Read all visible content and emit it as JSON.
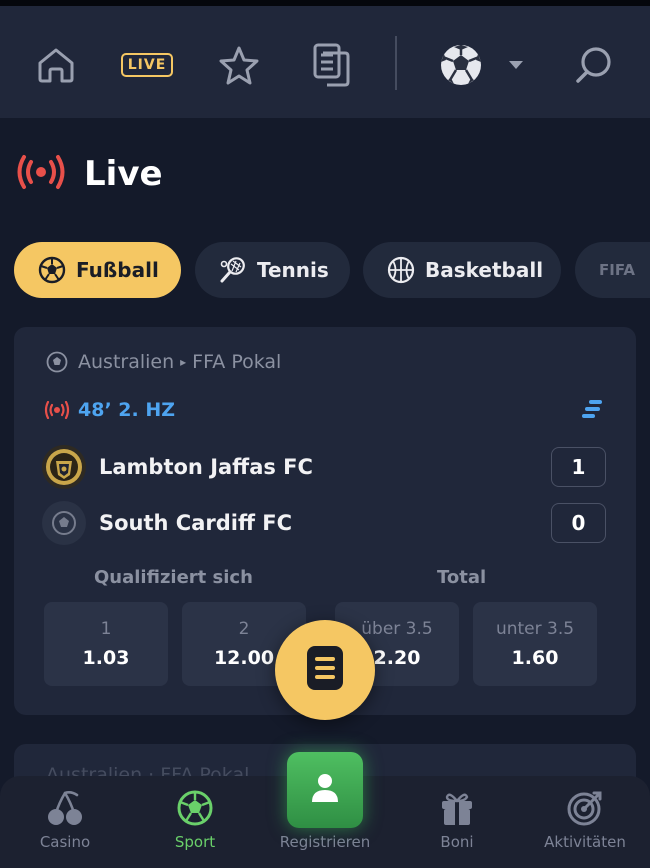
{
  "topbar": {
    "live_badge": "LIVE",
    "icons": [
      "home-icon",
      "live-badge",
      "star-icon",
      "betslip-icon",
      "soccer-ball-icon",
      "chevron-down-icon",
      "search-icon"
    ]
  },
  "section": {
    "title": "Live",
    "icon": "live-broadcast-icon"
  },
  "sports": [
    {
      "label": "Fußball",
      "icon": "soccer-ball-icon",
      "active": true
    },
    {
      "label": "Tennis",
      "icon": "tennis-racket-icon",
      "active": false
    },
    {
      "label": "Basketball",
      "icon": "basketball-icon",
      "active": false
    },
    {
      "label": "FIFA",
      "icon": "",
      "active": false
    }
  ],
  "match": {
    "country": "Australien",
    "league": "FFA Pokal",
    "time": "48’ 2. HZ",
    "teams": [
      {
        "name": "Lambton Jaffas FC",
        "score": "1"
      },
      {
        "name": "South Cardiff FC",
        "score": "0"
      }
    ],
    "markets": [
      {
        "title": "Qualifiziert sich",
        "odds": [
          {
            "label": "1",
            "value": "1.03"
          },
          {
            "label": "2",
            "value": "12.00"
          }
        ]
      },
      {
        "title": "Total",
        "odds": [
          {
            "label": "über 3.5",
            "value": "2.20"
          },
          {
            "label": "unter 3.5",
            "value": "1.60"
          }
        ]
      }
    ]
  },
  "next_match": {
    "hint": "Australien · FFA Pokal"
  },
  "nav": [
    {
      "label": "Casino",
      "icon": "cherries-icon",
      "active": false
    },
    {
      "label": "Sport",
      "icon": "soccer-ball-icon",
      "active": true
    },
    {
      "label": "Registrieren",
      "icon": "user-icon",
      "active": false
    },
    {
      "label": "Boni",
      "icon": "gift-icon",
      "active": false
    },
    {
      "label": "Aktivitäten",
      "icon": "target-icon",
      "active": false
    }
  ],
  "colors": {
    "accent": "#f5c763",
    "live_red": "#e8504a",
    "time_blue": "#4ea4f0",
    "nav_active": "#6ad06a",
    "register_green": "#3aa84f"
  }
}
